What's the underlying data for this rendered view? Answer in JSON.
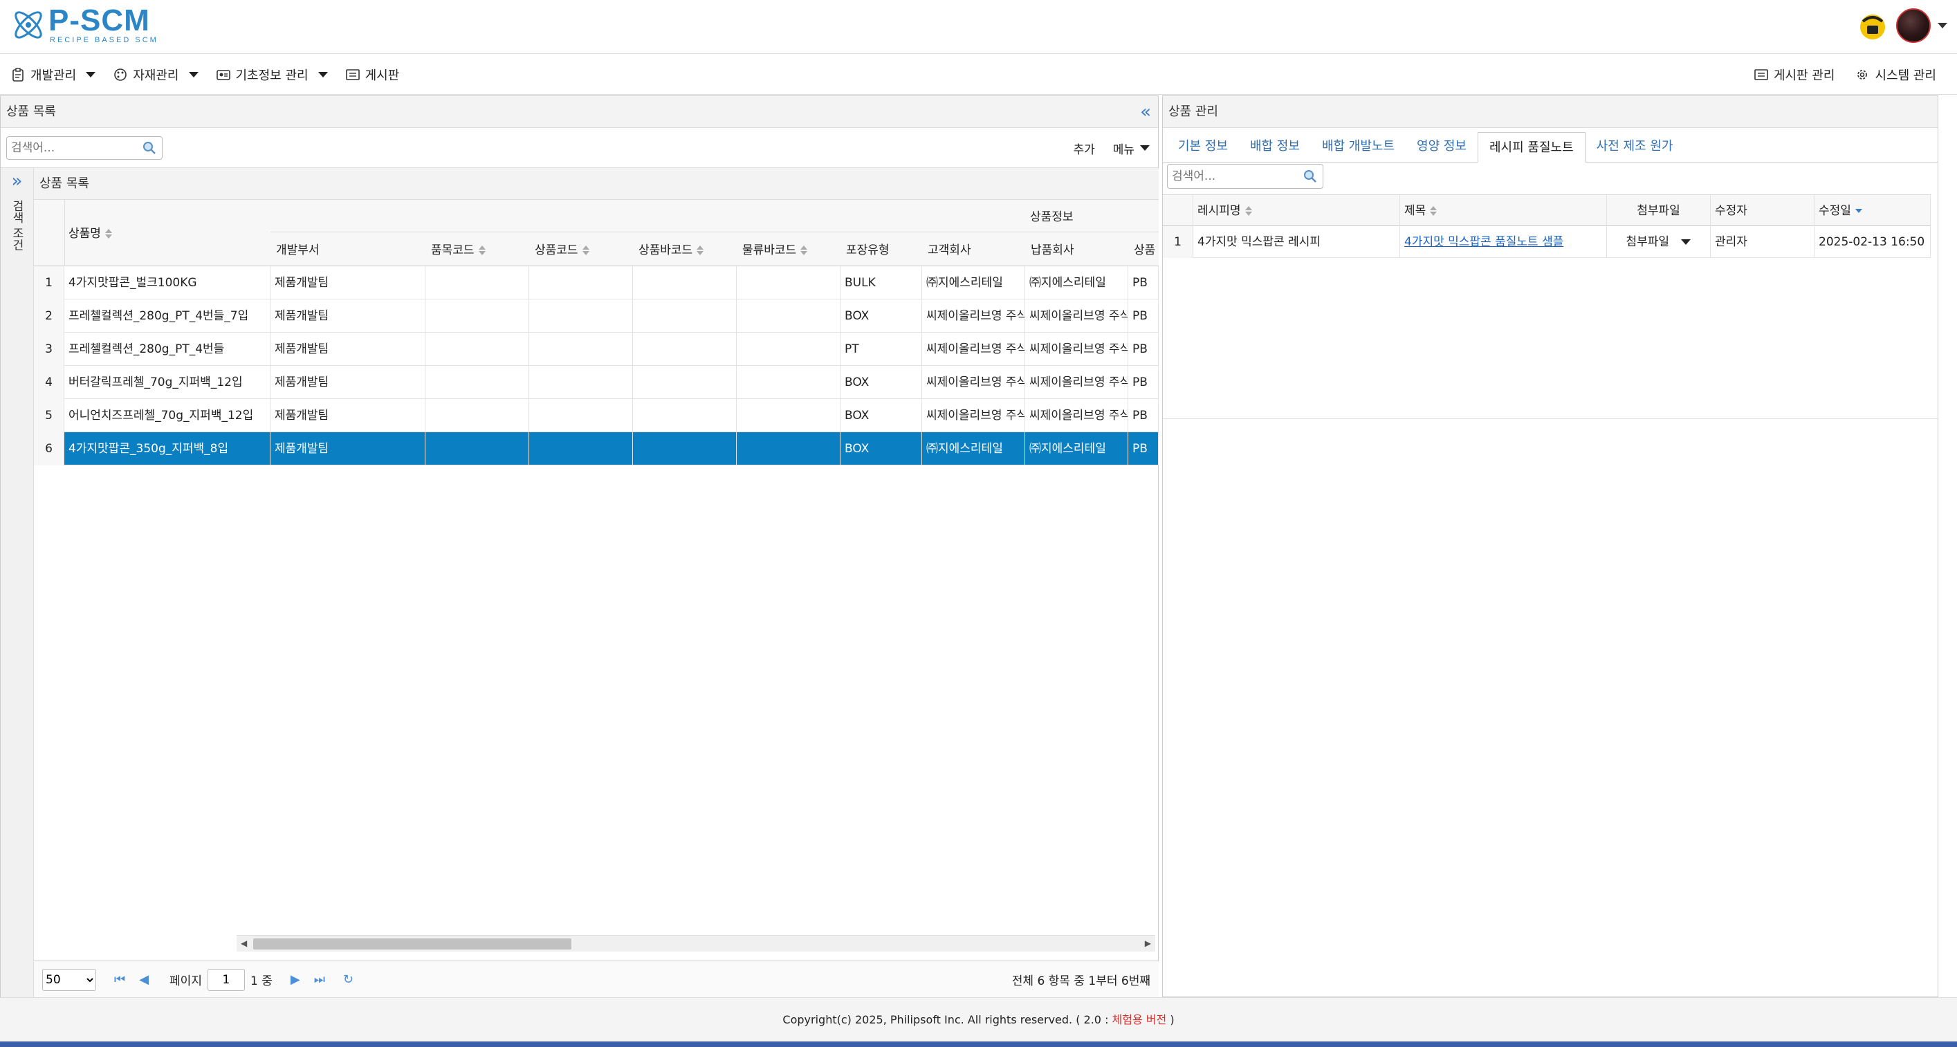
{
  "header": {
    "logo_title": "P-SCM",
    "logo_subtitle": "RECIPE BASED SCM"
  },
  "menu": {
    "left": [
      {
        "label": "개발관리",
        "icon": "clipboard-icon",
        "has_dropdown": true
      },
      {
        "label": "자재관리",
        "icon": "palette-icon",
        "has_dropdown": true
      },
      {
        "label": "기초정보 관리",
        "icon": "id-card-icon",
        "has_dropdown": true
      },
      {
        "label": "게시판",
        "icon": "list-icon",
        "has_dropdown": false
      }
    ],
    "right": [
      {
        "label": "게시판 관리",
        "icon": "list-icon"
      },
      {
        "label": "시스템 관리",
        "icon": "gear-icon"
      }
    ]
  },
  "left_panel": {
    "title": "상품 목록",
    "search_placeholder": "검색어...",
    "add_label": "추가",
    "menu_label": "메뉴",
    "side_label": "검색 조건",
    "grid_caption": "상품 목록",
    "group_header": "상품정보",
    "columns": [
      "상품명",
      "개발부서",
      "품목코드",
      "상품코드",
      "상품바코드",
      "물류바코드",
      "포장유형",
      "고객회사",
      "납품회사",
      "상품"
    ],
    "rows": [
      {
        "no": "1",
        "name": "4가지맛팝콘_벌크100KG",
        "dept": "제품개발팀",
        "item_code": "",
        "product_code": "",
        "product_barcode": "",
        "logistics_barcode": "",
        "pack_type": "BULK",
        "customer": "㈜지에스리테일",
        "supplier": "㈜지에스리테일",
        "extra": "PB"
      },
      {
        "no": "2",
        "name": "프레첼컬렉션_280g_PT_4번들_7입",
        "dept": "제품개발팀",
        "item_code": "",
        "product_code": "",
        "product_barcode": "",
        "logistics_barcode": "",
        "pack_type": "BOX",
        "customer": "씨제이올리브영 주식",
        "supplier": "씨제이올리브영 주식",
        "extra": "PB"
      },
      {
        "no": "3",
        "name": "프레첼컬렉션_280g_PT_4번들",
        "dept": "제품개발팀",
        "item_code": "",
        "product_code": "",
        "product_barcode": "",
        "logistics_barcode": "",
        "pack_type": "PT",
        "customer": "씨제이올리브영 주식",
        "supplier": "씨제이올리브영 주식",
        "extra": "PB"
      },
      {
        "no": "4",
        "name": "버터갈릭프레첼_70g_지퍼백_12입",
        "dept": "제품개발팀",
        "item_code": "",
        "product_code": "",
        "product_barcode": "",
        "logistics_barcode": "",
        "pack_type": "BOX",
        "customer": "씨제이올리브영 주식",
        "supplier": "씨제이올리브영 주식",
        "extra": "PB"
      },
      {
        "no": "5",
        "name": "어니언치즈프레첼_70g_지퍼백_12입",
        "dept": "제품개발팀",
        "item_code": "",
        "product_code": "",
        "product_barcode": "",
        "logistics_barcode": "",
        "pack_type": "BOX",
        "customer": "씨제이올리브영 주식",
        "supplier": "씨제이올리브영 주식",
        "extra": "PB"
      },
      {
        "no": "6",
        "name": "4가지맛팝콘_350g_지퍼백_8입",
        "dept": "제품개발팀",
        "item_code": "",
        "product_code": "",
        "product_barcode": "",
        "logistics_barcode": "",
        "pack_type": "BOX",
        "customer": "㈜지에스리테일",
        "supplier": "㈜지에스리테일",
        "extra": "PB",
        "selected": true
      }
    ],
    "pager": {
      "page_size": "50",
      "page_label": "페이지",
      "page_value": "1",
      "of_label": "1 중",
      "summary": "전체 6 항목 중 1부터 6번째"
    }
  },
  "right_panel": {
    "title": "상품 관리",
    "tabs": [
      {
        "label": "기본 정보",
        "active": false
      },
      {
        "label": "배합 정보",
        "active": false
      },
      {
        "label": "배합 개발노트",
        "active": false
      },
      {
        "label": "영양 정보",
        "active": false
      },
      {
        "label": "레시피 품질노트",
        "active": true
      },
      {
        "label": "사전 제조 원가",
        "active": false
      }
    ],
    "search_placeholder": "검색어...",
    "columns": [
      "레시피명",
      "제목",
      "첨부파일",
      "수정자",
      "수정일"
    ],
    "rows": [
      {
        "no": "1",
        "recipe": "4가지맛 믹스팝콘 레시피",
        "title": "4가지맛 믹스팝콘 품질노트 샘플",
        "attachment": "첨부파일",
        "editor": "관리자",
        "modified": "2025-02-13 16:50"
      }
    ]
  },
  "footer": {
    "copyright": "Copyright(c) 2025, Philipsoft Inc. All rights reserved. ( 2.0 : ",
    "edition": "체험용 버전",
    "close": " )"
  },
  "colors": {
    "brand": "#2c86c6",
    "selection": "#0a7fc2",
    "link": "#1a62c7",
    "edition_red": "#d9302c"
  }
}
